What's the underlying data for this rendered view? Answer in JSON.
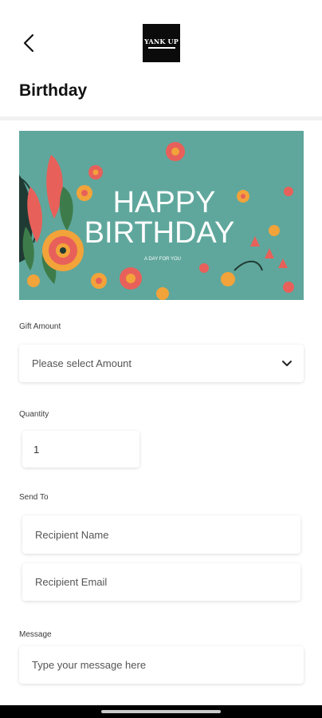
{
  "header": {
    "logo_text": "YANK UP",
    "title": "Birthday"
  },
  "card": {
    "headline_1": "HAPPY",
    "headline_2": "BIRTHDAY",
    "tagline": "A DAY FOR YOU",
    "bg_color": "#5fa79c"
  },
  "form": {
    "gift_amount_label": "Gift Amount",
    "gift_amount_placeholder": "Please select Amount",
    "quantity_label": "Quantity",
    "quantity_value": "1",
    "send_to_label": "Send To",
    "recipient_name_placeholder": "Recipient Name",
    "recipient_email_placeholder": "Recipient Email",
    "message_label": "Message",
    "message_placeholder": "Type your message here"
  }
}
